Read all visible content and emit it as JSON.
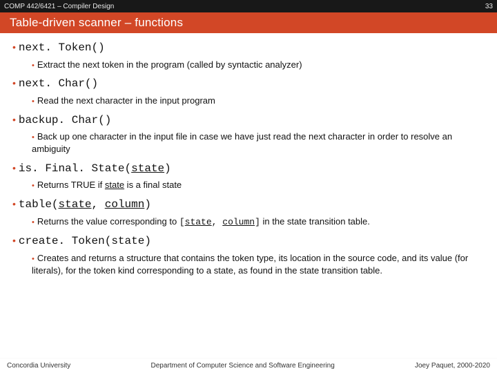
{
  "header": {
    "course": "COMP 442/6421 – Compiler Design",
    "page_number": "33",
    "title": "Table-driven scanner – functions"
  },
  "functions": [
    {
      "name_parts": [
        "next. Token()"
      ],
      "desc_parts": [
        "Extract the next token in the program (called by syntactic analyzer)"
      ]
    },
    {
      "name_parts": [
        "next. Char()"
      ],
      "desc_parts": [
        "Read the next character in the input program"
      ]
    },
    {
      "name_parts": [
        "backup. Char()"
      ],
      "desc_parts": [
        "Back up one character in the input file in case we have just read the next character in order to resolve an ambiguity"
      ]
    },
    {
      "name_parts": [
        "is. Final. State(",
        {
          "u": "state"
        },
        ")"
      ],
      "desc_parts": [
        "Returns TRUE if ",
        {
          "u": "state"
        },
        " is a final state"
      ]
    },
    {
      "name_parts": [
        "table(",
        {
          "u": "state"
        },
        ", ",
        {
          "u": "column"
        },
        ")"
      ],
      "desc_parts": [
        "Returns the value corresponding to ",
        {
          "mono": "["
        },
        {
          "mono_u": "state"
        },
        {
          "mono": ", "
        },
        {
          "mono_u": "column"
        },
        {
          "mono": "]"
        },
        " in the state transition table."
      ]
    },
    {
      "name_parts": [
        "create. Token(state)"
      ],
      "desc_parts": [
        "Creates and returns a structure that contains the token type, its location in the source code, and its value (for literals), for the token kind corresponding to a state, as found in the state transition table."
      ]
    }
  ],
  "footer": {
    "left": "Concordia University",
    "center": "Department of Computer Science and Software Engineering",
    "right": "Joey Paquet, 2000-2020"
  }
}
